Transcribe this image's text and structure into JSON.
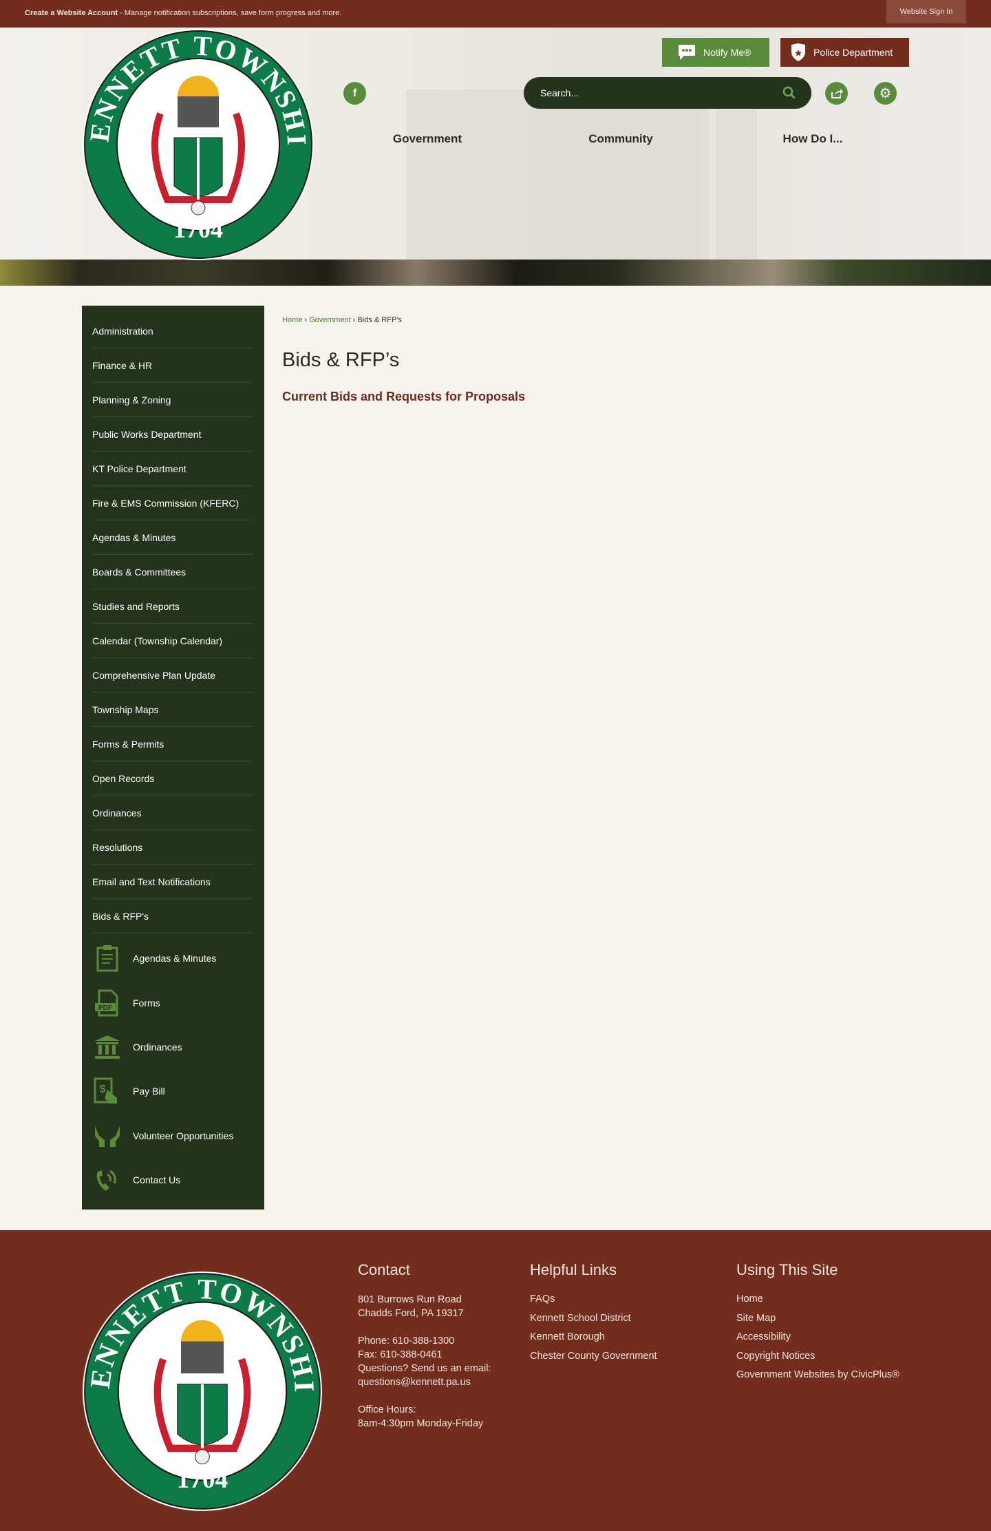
{
  "topbar": {
    "create_account": "Create a Website Account",
    "message": " - Manage notification subscriptions, save form progress and more.",
    "sign_in": "Website Sign In"
  },
  "logo": {
    "top_text": "KENNETT TOWNSHIP",
    "year": "1704"
  },
  "header": {
    "notify": "Notify Me®",
    "police": "Police Department",
    "search_placeholder": "Search...",
    "facebook_icon": "facebook-icon",
    "share_icon": "share-icon",
    "settings_icon": "gear-icon"
  },
  "nav": [
    "Government",
    "Community",
    "How Do I..."
  ],
  "sidebar": {
    "items": [
      "Administration",
      "Finance & HR",
      "Planning & Zoning",
      "Public Works Department",
      "KT Police Department",
      "Fire & EMS Commission (KFERC)",
      "Agendas & Minutes",
      "Boards & Committees",
      "Studies and Reports",
      "Calendar (Township Calendar)",
      "Comprehensive Plan Update",
      "Township Maps",
      "Forms & Permits",
      "Open Records",
      "Ordinances",
      "Resolutions",
      "Email and Text Notifications",
      "Bids & RFP's"
    ],
    "quick_links": [
      {
        "label": "Agendas & Minutes",
        "icon": "clipboard-icon"
      },
      {
        "label": "Forms",
        "icon": "pdf-icon"
      },
      {
        "label": "Ordinances",
        "icon": "building-icon"
      },
      {
        "label": "Pay Bill",
        "icon": "pay-bill-icon"
      },
      {
        "label": "Volunteer Opportunities",
        "icon": "hands-icon"
      },
      {
        "label": "Contact Us",
        "icon": "phone-icon"
      }
    ]
  },
  "breadcrumb": {
    "home": "Home",
    "government": "Government",
    "current": "Bids & RFP's"
  },
  "main": {
    "title": "Bids & RFP’s",
    "subtitle": "Current Bids and Requests for Proposals"
  },
  "footer": {
    "contact": {
      "heading": "Contact",
      "address1": "801 Burrows Run Road",
      "address2": "Chadds Ford, PA 19317",
      "phone": "Phone: 610-388-1300",
      "fax": "Fax: 610-388-0461",
      "email_prompt": "Questions? Send us an email:",
      "email": "questions@kennett.pa.us",
      "hours_label": "Office Hours:",
      "hours": "8am-4:30pm Monday-Friday"
    },
    "helpful": {
      "heading": "Helpful Links",
      "links": [
        "FAQs",
        "Kennett School District",
        "Kennett Borough",
        "Chester County Government"
      ]
    },
    "using": {
      "heading": "Using This Site",
      "links": [
        "Home",
        "Site Map",
        "Accessibility",
        "Copyright Notices",
        "Government Websites by CivicPlus®"
      ]
    }
  },
  "colors": {
    "brand_red": "#722d1e",
    "brand_green": "#5a8a3c",
    "sidebar_dark": "#25331c",
    "seal_green": "#0e7a48"
  }
}
